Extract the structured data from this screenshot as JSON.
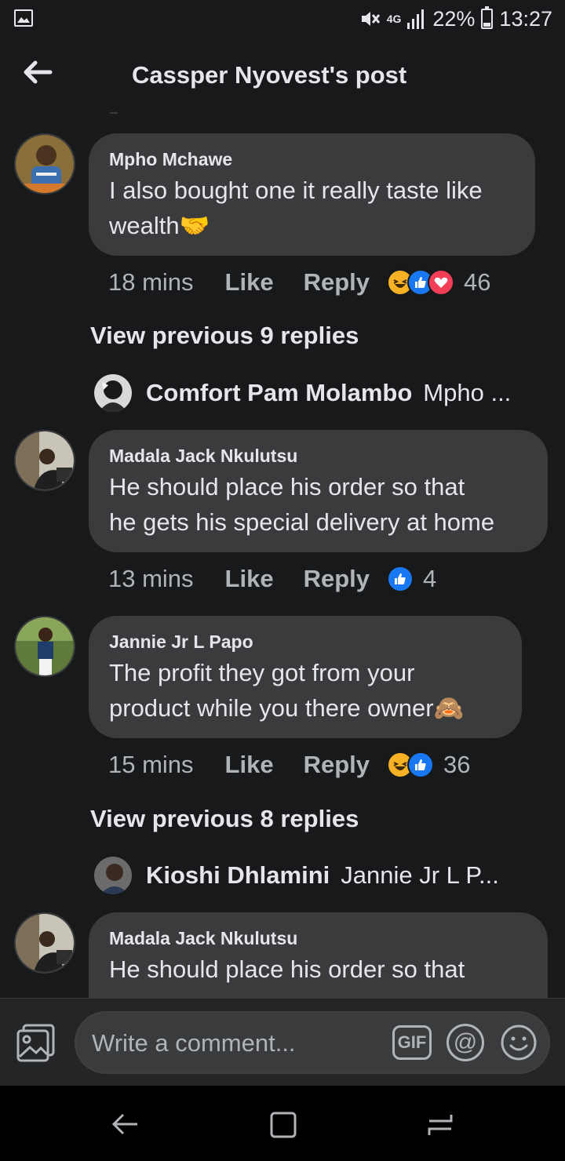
{
  "status_bar": {
    "network": "4G",
    "battery_percent": "22%",
    "battery_level": 0.22,
    "time": "13:27"
  },
  "header": {
    "title": "Cassper Nyovest's post"
  },
  "comments": [
    {
      "name": "Mpho Mchawe",
      "text_lines": [
        "I also bought one it really taste like",
        "wealth🤝"
      ],
      "time": "18 mins",
      "like_label": "Like",
      "reply_label": "Reply",
      "reactions": [
        "haha",
        "like",
        "love"
      ],
      "reaction_count": "46"
    },
    {
      "name": "Madala Jack Nkulutsu",
      "text_lines": [
        "He should place his order so that",
        "he gets his special delivery at home"
      ],
      "time": "13 mins",
      "like_label": "Like",
      "reply_label": "Reply",
      "reactions": [
        "like"
      ],
      "reaction_count": "4"
    },
    {
      "name": "Jannie Jr L Papo",
      "text_lines": [
        "The profit they got from your",
        "product while you there owner🙈"
      ],
      "time": "15 mins",
      "like_label": "Like",
      "reply_label": "Reply",
      "reactions": [
        "haha",
        "like"
      ],
      "reaction_count": "36"
    },
    {
      "name": "Madala Jack Nkulutsu",
      "text_lines": [
        "He should place his order so that"
      ]
    }
  ],
  "reply_threads": [
    {
      "view_previous": "View previous 9 replies",
      "latest_name": "Comfort Pam Molambo",
      "latest_preview": "Mpho ..."
    },
    {
      "view_previous": "View previous 8 replies",
      "latest_name": "Kioshi Dhlamini",
      "latest_preview": "Jannie Jr L P..."
    }
  ],
  "composer": {
    "placeholder": "Write a comment...",
    "gif_label": "GIF",
    "at_label": "@"
  },
  "colors": {
    "background": "#18191a",
    "bubble": "#3a3b3c",
    "text_primary": "#e4e6eb",
    "text_secondary": "#b0b3b8",
    "like_blue": "#1877f2",
    "haha_yellow": "#f7b125",
    "love_red": "#f33e58"
  }
}
